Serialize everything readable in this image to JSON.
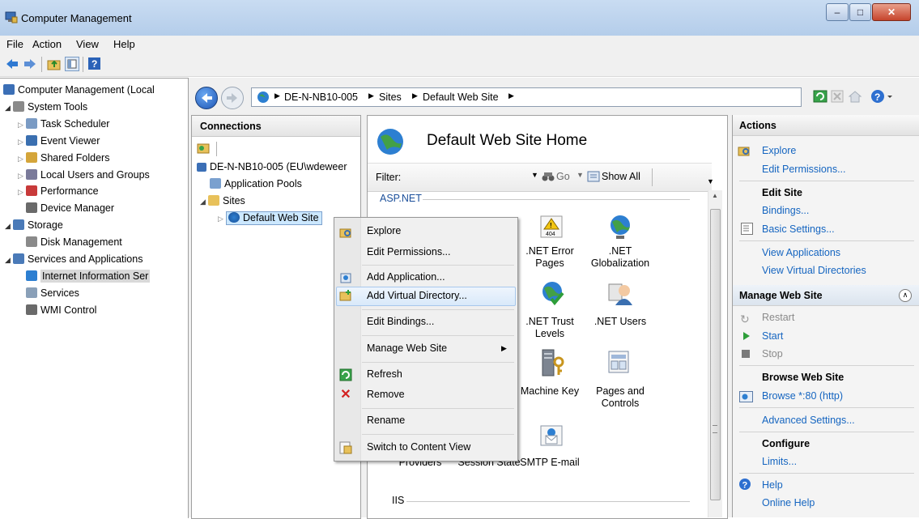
{
  "window": {
    "title": "Computer Management"
  },
  "menubar": [
    "File",
    "Action",
    "View",
    "Help"
  ],
  "tree": {
    "items": [
      {
        "label": "Computer Management (Local",
        "level": 0,
        "expander": ""
      },
      {
        "label": "System Tools",
        "level": 1,
        "expander": "open"
      },
      {
        "label": "Task Scheduler",
        "level": 2,
        "expander": "closed"
      },
      {
        "label": "Event Viewer",
        "level": 2,
        "expander": "closed"
      },
      {
        "label": "Shared Folders",
        "level": 2,
        "expander": "closed"
      },
      {
        "label": "Local Users and Groups",
        "level": 2,
        "expander": "closed"
      },
      {
        "label": "Performance",
        "level": 2,
        "expander": "closed"
      },
      {
        "label": "Device Manager",
        "level": 2,
        "expander": ""
      },
      {
        "label": "Storage",
        "level": 1,
        "expander": "open"
      },
      {
        "label": "Disk Management",
        "level": 2,
        "expander": ""
      },
      {
        "label": "Services and Applications",
        "level": 1,
        "expander": "open"
      },
      {
        "label": "Internet Information Ser",
        "level": 2,
        "expander": "",
        "selected": true
      },
      {
        "label": "Services",
        "level": 2,
        "expander": ""
      },
      {
        "label": "WMI Control",
        "level": 2,
        "expander": ""
      }
    ]
  },
  "address": {
    "segments": [
      "DE-N-NB10-005",
      "Sites",
      "Default Web Site"
    ]
  },
  "connections": {
    "header": "Connections",
    "items": [
      {
        "label": "DE-N-NB10-005 (EU\\wdeweer"
      },
      {
        "label": "Application Pools"
      },
      {
        "label": "Sites"
      },
      {
        "label": "Default Web Site"
      }
    ]
  },
  "main": {
    "title": "Default Web Site Home",
    "filter_label": "Filter:",
    "go_label": "Go",
    "show_all_label": "Show All",
    "group_aspnet": "ASP.NET",
    "group_iis": "IIS",
    "features": [
      {
        "label": ".NET Error\nPages",
        "icon": "error-page-icon"
      },
      {
        "label": ".NET\nGlobalization",
        "icon": "globe-icon"
      },
      {
        "label": ".NET Trust\nLevels",
        "icon": "globe-check-icon"
      },
      {
        "label": ".NET Users",
        "icon": "users-icon"
      },
      {
        "label": "Machine Key",
        "icon": "server-key-icon"
      },
      {
        "label": "Pages and\nControls",
        "icon": "pages-icon"
      },
      {
        "label": "Providers",
        "icon": ""
      },
      {
        "label": "Session State",
        "icon": ""
      },
      {
        "label": "SMTP E-mail",
        "icon": "email-icon"
      }
    ]
  },
  "context_menu": {
    "items": [
      "Explore",
      "Edit Permissions...",
      "Add Application...",
      "Add Virtual Directory...",
      "Edit Bindings...",
      "Manage Web Site",
      "Refresh",
      "Remove",
      "Rename",
      "Switch to Content View"
    ]
  },
  "actions": {
    "header": "Actions",
    "explore": "Explore",
    "edit_permissions": "Edit Permissions...",
    "edit_site": "Edit Site",
    "bindings": "Bindings...",
    "basic_settings": "Basic Settings...",
    "view_applications": "View Applications",
    "view_virtual_directories": "View Virtual Directories",
    "manage_header": "Manage Web Site",
    "restart": "Restart",
    "start": "Start",
    "stop": "Stop",
    "browse_header": "Browse Web Site",
    "browse_80": "Browse *:80 (http)",
    "advanced_settings": "Advanced Settings...",
    "configure": "Configure",
    "limits": "Limits...",
    "help": "Help",
    "online_help": "Online Help"
  },
  "colors": {
    "link": "#1565c0",
    "selection": "#cce8ff",
    "titlebar": "#c9dcf2"
  }
}
